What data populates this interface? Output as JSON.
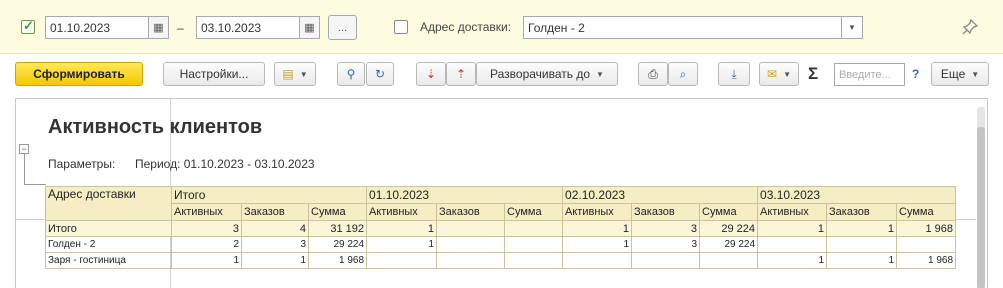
{
  "filter": {
    "date_from": "01.10.2023",
    "date_to": "03.10.2023",
    "dash": "–",
    "more": "...",
    "address_label": "Адрес доставки:",
    "address_value": "Голден - 2",
    "period_enabled": true,
    "address_enabled": false
  },
  "toolbar": {
    "generate": "Сформировать",
    "settings": "Настройки...",
    "expand_to": "Разворачивать до",
    "search_placeholder": "Введите...",
    "help": "?",
    "more": "Еще",
    "sigma": "Σ"
  },
  "report": {
    "title": "Активность клиентов",
    "params_label": "Параметры:",
    "params_value": "Период: 01.10.2023 - 03.10.2023",
    "collapse": "−",
    "col_address": "Адрес доставки",
    "groups": [
      "Итого",
      "01.10.2023",
      "02.10.2023",
      "03.10.2023"
    ],
    "subheaders": [
      "Активных",
      "Заказов",
      "Сумма"
    ],
    "rows": [
      {
        "name": "Итого",
        "cells": [
          "3",
          "4",
          "31 192",
          "1",
          "",
          "",
          "1",
          "3",
          "29 224",
          "1",
          "1",
          "1 968"
        ]
      },
      {
        "name": "Голден - 2",
        "cells": [
          "2",
          "3",
          "29 224",
          "1",
          "",
          "",
          "1",
          "3",
          "29 224",
          "",
          "",
          ""
        ]
      },
      {
        "name": "Заря - гостиница",
        "cells": [
          "1",
          "1",
          "1 968",
          "",
          "",
          "",
          "",
          "",
          "",
          "1",
          "1",
          "1 968"
        ]
      }
    ]
  },
  "colors": {
    "header_bg": "#f5eec4",
    "filter_bg": "#fdfbe0",
    "primary_btn": "#f4c800",
    "accent": "#2b6ab5",
    "check": "#4a9a2a"
  },
  "icons": [
    "checkmark-icon",
    "calendar-icon",
    "pin-icon",
    "variants-icon",
    "search-icon",
    "search-refresh-icon",
    "sort-asc-icon",
    "sort-desc-icon",
    "print-icon",
    "print-preview-icon",
    "download-icon",
    "mail-icon",
    "sigma-icon",
    "help-icon"
  ]
}
